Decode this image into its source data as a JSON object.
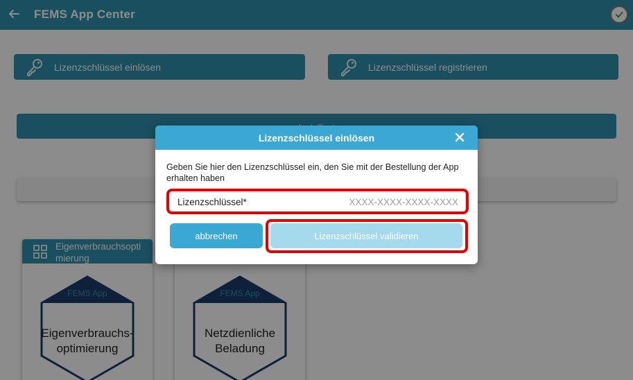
{
  "header": {
    "title": "FEMS App Center",
    "back_icon": "arrow-left-icon",
    "status_icon": "check-circle-icon"
  },
  "actions": {
    "redeem_label": "Lizenzschlüssel einlösen",
    "register_label": "Lizenzschlüssel registrieren",
    "icon": "key-icon"
  },
  "installed_label": "Installiert",
  "cards": [
    {
      "header": "Eigenverbrauchsoptimierung",
      "brand": "FEMS App",
      "name": "Eigenverbrauchs-\noptimierung"
    },
    {
      "header": "",
      "brand": "FEMS App",
      "name": "Netzdienliche\nBeladung"
    }
  ],
  "dialog": {
    "title": "Lizenzschlüssel einlösen",
    "description": "Geben Sie hier den Lizenzschlüssel ein, den Sie mit der Bestellung der App erhalten haben",
    "field_label": "Lizenzschlüssel*",
    "field_placeholder": "XXXX-XXXX-XXXX-XXXX",
    "field_value": "",
    "cancel_label": "abbrechen",
    "validate_label": "Lizenzschlüssel validieren",
    "close_icon": "close-icon"
  },
  "colors": {
    "primary": "#2e90ad",
    "dialog_header": "#3aa8d2",
    "disabled_button": "#a5d9ec",
    "highlight": "#e40000"
  }
}
